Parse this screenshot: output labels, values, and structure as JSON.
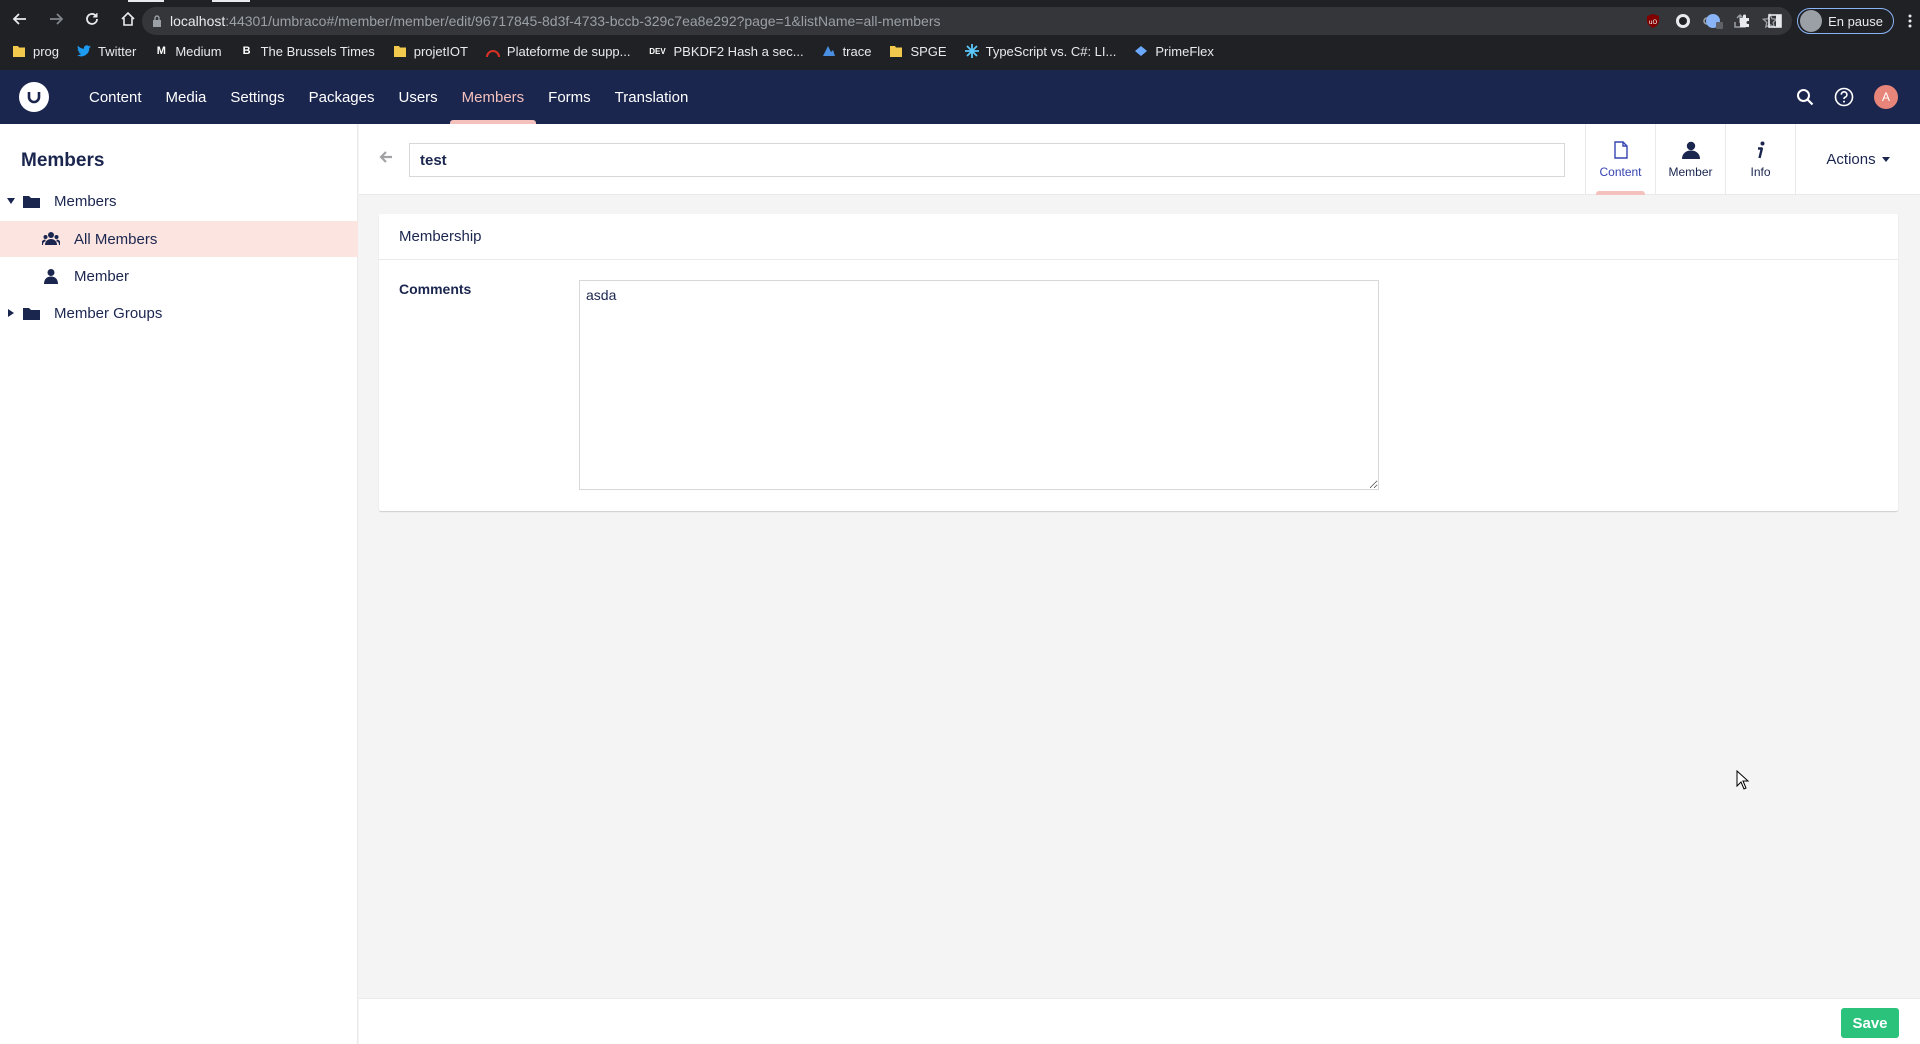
{
  "browser": {
    "url_host": "localhost",
    "url_rest": ":44301/umbraco#/member/member/edit/96717845-8d3f-4733-bccb-329c7ea8e292?page=1&listName=all-members",
    "profile_label": "En pause",
    "bookmarks": [
      {
        "label": "prog",
        "icon": "folder-icon",
        "color": "#f2c94c"
      },
      {
        "label": "Twitter",
        "icon": "twitter-icon",
        "color": "#1d9bf0"
      },
      {
        "label": "Medium",
        "icon": "medium-icon",
        "color": "#ffffff"
      },
      {
        "label": "The Brussels Times",
        "icon": "brussels-times-icon",
        "color": "#ffffff"
      },
      {
        "label": "projetIOT",
        "icon": "folder-icon",
        "color": "#f2c94c"
      },
      {
        "label": "Plateforme de supp...",
        "icon": "plateforme-icon",
        "color": "#d93025"
      },
      {
        "label": "PBKDF2 Hash a sec...",
        "icon": "dev-icon",
        "color": "#ffffff"
      },
      {
        "label": "trace",
        "icon": "trace-icon",
        "color": "#4a90e2"
      },
      {
        "label": "SPGE",
        "icon": "folder-icon",
        "color": "#f2c94c"
      },
      {
        "label": "TypeScript vs. C#: LI...",
        "icon": "snowflake-icon",
        "color": "#5ac8fa"
      },
      {
        "label": "PrimeFlex",
        "icon": "primeflex-icon",
        "color": "#6aa9ff"
      }
    ]
  },
  "header": {
    "sections": [
      "Content",
      "Media",
      "Settings",
      "Packages",
      "Users",
      "Members",
      "Forms",
      "Translation"
    ],
    "active_section": "Members",
    "avatar_initial": "A"
  },
  "tree": {
    "title": "Members",
    "nodes": [
      {
        "label": "Members"
      },
      {
        "label": "All Members"
      },
      {
        "label": "Member"
      },
      {
        "label": "Member Groups"
      }
    ]
  },
  "editor": {
    "name_value": "test",
    "tabs": [
      {
        "label": "Content",
        "icon": "document-icon"
      },
      {
        "label": "Member",
        "icon": "user-icon"
      },
      {
        "label": "Info",
        "icon": "info-icon"
      }
    ],
    "actions_label": "Actions",
    "group_title": "Membership",
    "property_label": "Comments",
    "property_value": "asda",
    "save_label": "Save"
  },
  "colors": {
    "header_bg": "#1b264f",
    "accent_pink": "#f5c1bc",
    "active_tree_bg": "#fce4e1",
    "save_green": "#2bc37c"
  }
}
